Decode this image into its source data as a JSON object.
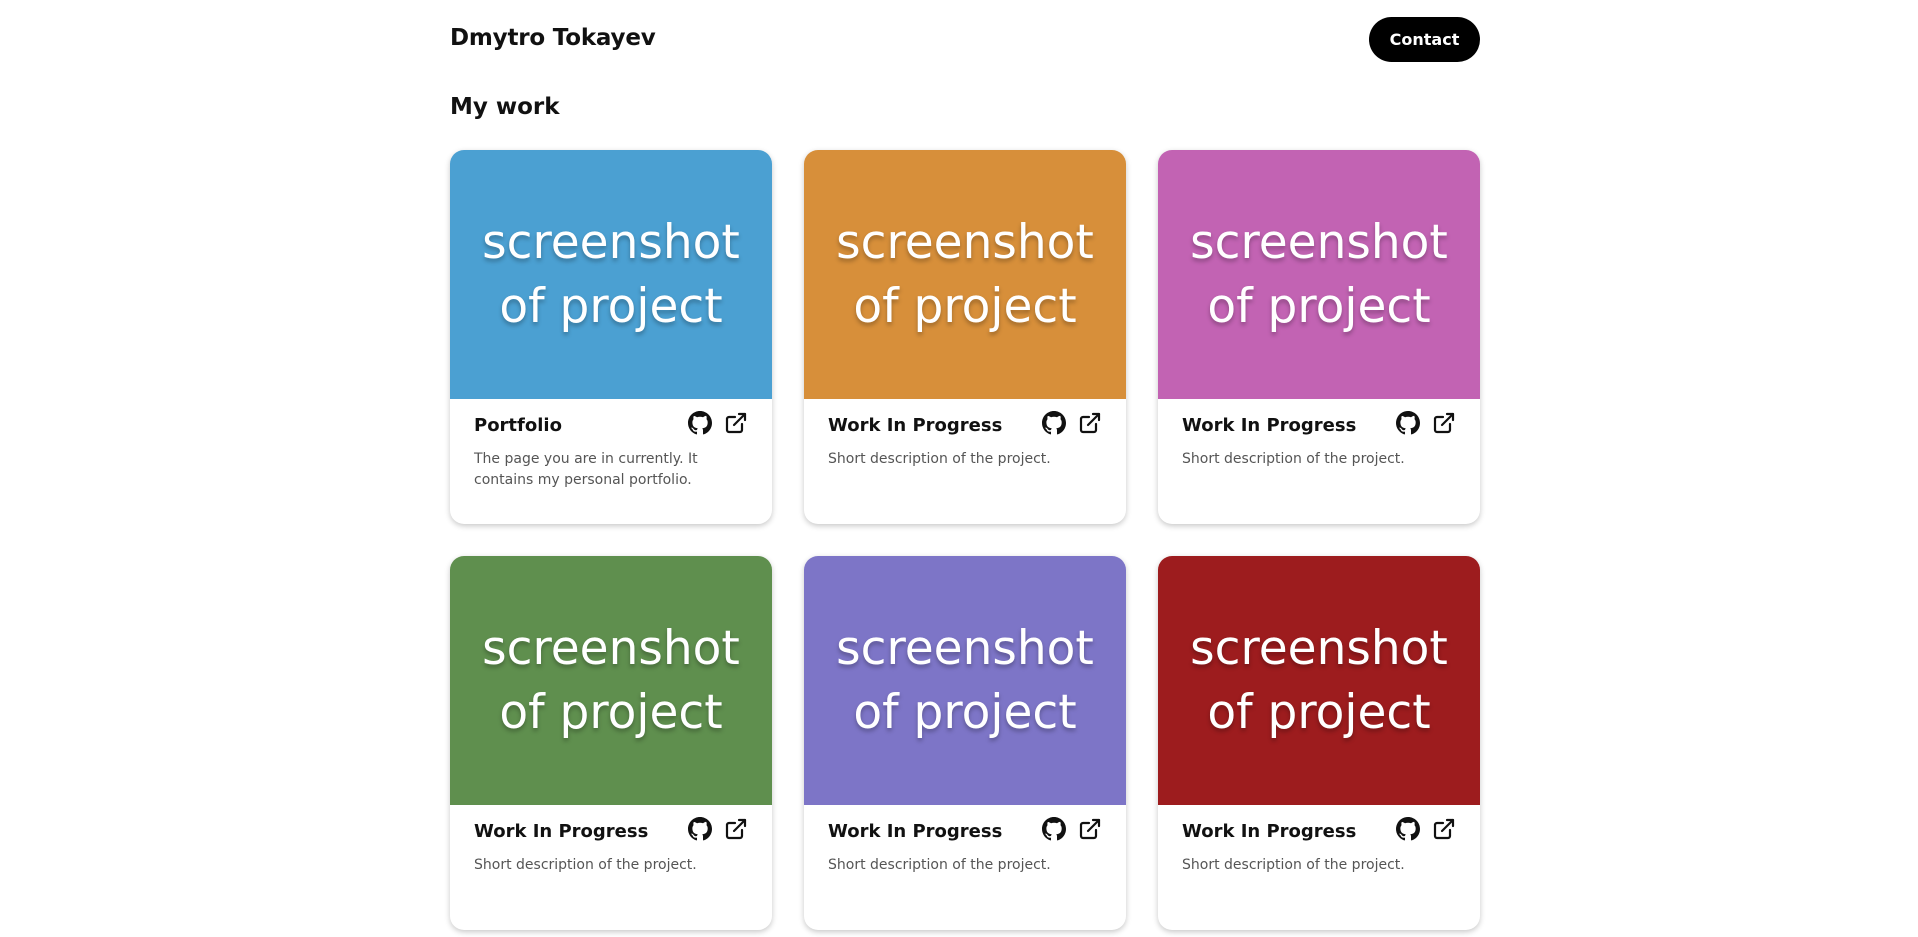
{
  "header": {
    "title": "Dmytro Tokayev",
    "contact_label": "Contact"
  },
  "section": {
    "title": "My work"
  },
  "projects": [
    {
      "image_text": "screenshot of project",
      "image_color": "#4BA0D2",
      "title": "Portfolio",
      "description": "The page you are in currently. It contains my personal portfolio.",
      "icons": [
        "github-icon",
        "external-link-icon"
      ]
    },
    {
      "image_text": "screenshot of project",
      "image_color": "#D78F3A",
      "title": "Work In Progress",
      "description": "Short description of the project.",
      "icons": [
        "github-icon",
        "external-link-icon"
      ]
    },
    {
      "image_text": "screenshot of project",
      "image_color": "#C263B3",
      "title": "Work In Progress",
      "description": "Short description of the project.",
      "icons": [
        "github-icon",
        "external-link-icon"
      ]
    },
    {
      "image_text": "screenshot of project",
      "image_color": "#5F8F4E",
      "title": "Work In Progress",
      "description": "Short description of the project.",
      "icons": [
        "github-icon",
        "external-link-icon"
      ]
    },
    {
      "image_text": "screenshot of project",
      "image_color": "#7D75C7",
      "title": "Work In Progress",
      "description": "Short description of the project.",
      "icons": [
        "github-icon",
        "external-link-icon"
      ]
    },
    {
      "image_text": "screenshot of project",
      "image_color": "#9D1C1E",
      "title": "Work In Progress",
      "description": "Short description of the project.",
      "icons": [
        "github-icon",
        "external-link-icon"
      ]
    }
  ]
}
